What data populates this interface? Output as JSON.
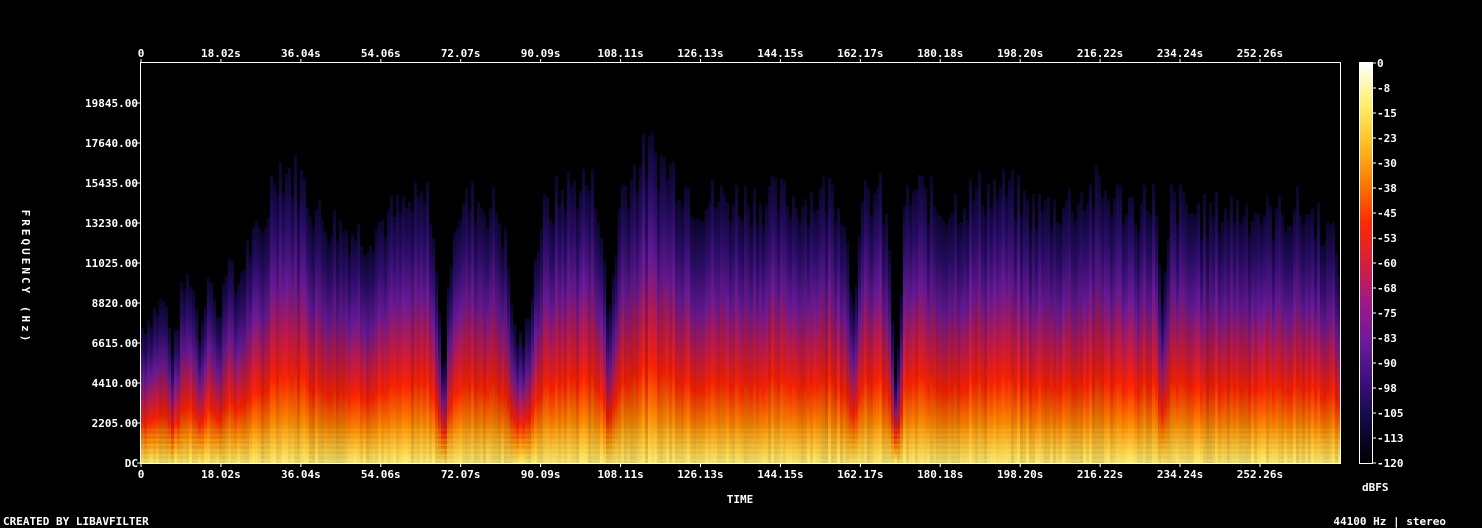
{
  "chart_data": {
    "type": "heatmap",
    "subtype": "spectrogram",
    "xlabel": "TIME",
    "ylabel": "FREQUENCY (Hz)",
    "x_ticks": [
      "0",
      "18.02s",
      "36.04s",
      "54.06s",
      "72.07s",
      "90.09s",
      "108.11s",
      "126.13s",
      "144.15s",
      "162.17s",
      "180.18s",
      "198.20s",
      "216.22s",
      "234.24s",
      "252.26s"
    ],
    "x_tick_values": [
      0,
      18.02,
      36.04,
      54.06,
      72.07,
      90.09,
      108.11,
      126.13,
      144.15,
      162.17,
      180.18,
      198.2,
      216.22,
      234.24,
      252.26
    ],
    "xlim": [
      0,
      270.3
    ],
    "y_ticks": [
      "DC",
      "2205.00",
      "4410.00",
      "6615.00",
      "8820.00",
      "11025.00",
      "13230.00",
      "15435.00",
      "17640.00",
      "19845.00"
    ],
    "y_tick_values": [
      0,
      2205,
      4410,
      6615,
      8820,
      11025,
      13230,
      15435,
      17640,
      19845
    ],
    "ylim": [
      0,
      22050
    ],
    "colorbar": {
      "label": "dBFS",
      "ticks": [
        "0",
        "-8",
        "-15",
        "-23",
        "-30",
        "-38",
        "-45",
        "-53",
        "-60",
        "-68",
        "-75",
        "-83",
        "-90",
        "-98",
        "-105",
        "-113",
        "-120"
      ],
      "range": [
        -120,
        0
      ],
      "colors": [
        "#000000",
        "#0e0a40",
        "#3a0f7a",
        "#6a1a9a",
        "#a0188a",
        "#d81e3a",
        "#ff2a00",
        "#ff7a00",
        "#ffc020",
        "#fff070",
        "#ffffff"
      ]
    },
    "energy_envelope": {
      "t": [
        0,
        3,
        5,
        7,
        9,
        11,
        13,
        15,
        17,
        19,
        21,
        24,
        27,
        30,
        33,
        36,
        40,
        45,
        50,
        55,
        60,
        65,
        68,
        70,
        72,
        75,
        80,
        82,
        84,
        86,
        88,
        90,
        95,
        100,
        103,
        105,
        108,
        112,
        115,
        120,
        125,
        130,
        135,
        140,
        145,
        150,
        155,
        158,
        160,
        163,
        166,
        168,
        170,
        172,
        175,
        180,
        185,
        190,
        195,
        200,
        205,
        210,
        215,
        220,
        225,
        228,
        230,
        232,
        235,
        240,
        245,
        250,
        255,
        260,
        265,
        268,
        270.3
      ],
      "cutoff_hz": [
        7500,
        8500,
        9000,
        6000,
        9500,
        10500,
        7000,
        11000,
        7500,
        11500,
        9500,
        12000,
        12500,
        16500,
        16000,
        15500,
        13500,
        13000,
        12500,
        13500,
        14000,
        14500,
        4500,
        13500,
        14000,
        14500,
        14000,
        12000,
        7000,
        6500,
        10000,
        13500,
        15000,
        15500,
        14500,
        7500,
        15000,
        16500,
        17000,
        16000,
        14500,
        14500,
        14500,
        14500,
        14500,
        14500,
        15000,
        14500,
        9000,
        14500,
        15000,
        13000,
        3500,
        14500,
        15000,
        14000,
        14500,
        15000,
        15000,
        14000,
        14000,
        14500,
        15000,
        14500,
        14000,
        15000,
        8000,
        14500,
        14000,
        13500,
        14000,
        14000,
        13500,
        14000,
        13500,
        12500,
        11000
      ]
    }
  },
  "footer": {
    "left": "CREATED BY LIBAVFILTER",
    "right": "44100 Hz | stereo"
  }
}
